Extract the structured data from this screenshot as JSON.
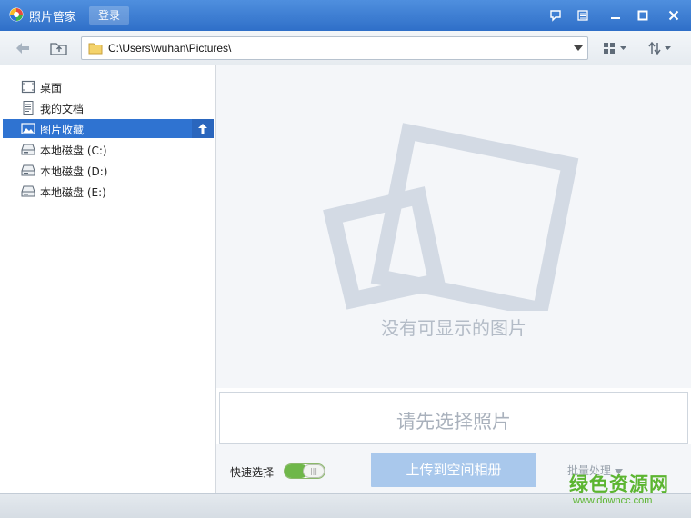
{
  "window": {
    "title": "照片管家",
    "login_label": "登录"
  },
  "toolbar": {
    "path": "C:\\Users\\wuhan\\Pictures\\"
  },
  "sidebar": {
    "items": [
      {
        "label": "桌面",
        "icon": "desktop-icon"
      },
      {
        "label": "我的文档",
        "icon": "document-icon"
      },
      {
        "label": "图片收藏",
        "icon": "picture-icon",
        "selected": true
      },
      {
        "label": "本地磁盘 (C:)",
        "icon": "drive-icon"
      },
      {
        "label": "本地磁盘 (D:)",
        "icon": "drive-icon"
      },
      {
        "label": "本地磁盘 (E:)",
        "icon": "drive-icon"
      }
    ]
  },
  "main": {
    "empty_text": "没有可显示的图片",
    "select_prompt": "请先选择照片"
  },
  "bottom": {
    "quick_select_label": "快速选择",
    "quick_select_on": true,
    "upload_label": "上传到空间相册",
    "batch_label": "批量处理"
  },
  "watermark": {
    "title": "绿色资源网",
    "url": "www.downcc.com"
  },
  "colors": {
    "titlebar": "#3a7bd5",
    "selection": "#2f73d1",
    "upload_button": "#a9c8ec",
    "toggle_on": "#6fb74a",
    "watermark": "#5cb531"
  }
}
